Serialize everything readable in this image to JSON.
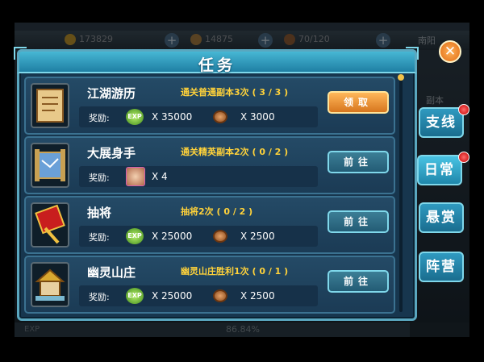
{
  "hud": {
    "res1": "173829",
    "res2": "14875",
    "res3": "70/120",
    "right_tag": "南阳",
    "side_label": "副本",
    "exp_label": "EXP",
    "exp_percent": "86.84%",
    "exp_fraction": 0.8684
  },
  "window": {
    "title": "任务",
    "close_icon": "close-x-icon"
  },
  "tasks": [
    {
      "name": "江湖游历",
      "desc": "通关普通副本3次 ( 3 / 3 )",
      "icon": "scroll-icon",
      "reward_label": "奖励:",
      "reward1_icon": "exp-icon",
      "reward1_amount": "X 35000",
      "reward2_icon": "copper-coin-icon",
      "reward2_amount": "X 3000",
      "button": "领取",
      "button_type": "claim"
    },
    {
      "name": "大展身手",
      "desc": "通关精英副本2次 ( 0 / 2 )",
      "icon": "map-scroll-icon",
      "reward_label": "奖励:",
      "reward1_icon": "hero-portrait-icon",
      "reward1_amount": "X 4",
      "button": "前往",
      "button_type": "go"
    },
    {
      "name": "抽将",
      "desc": "抽将2次 ( 0 / 2 )",
      "icon": "command-token-icon",
      "reward_label": "奖励:",
      "reward1_icon": "exp-icon",
      "reward1_amount": "X 25000",
      "reward2_icon": "copper-coin-icon",
      "reward2_amount": "X 2500",
      "button": "前往",
      "button_type": "go"
    },
    {
      "name": "幽灵山庄",
      "desc": "幽灵山庄胜利1次 ( 0 / 1 )",
      "icon": "mansion-icon",
      "reward_label": "奖励:",
      "reward1_icon": "exp-icon",
      "reward1_amount": "X 25000",
      "reward2_icon": "copper-coin-icon",
      "reward2_amount": "X 2500",
      "button": "前往",
      "button_type": "go"
    }
  ],
  "exp_icon_text": "EXP",
  "side_tabs": [
    {
      "label": "支线",
      "badge": true,
      "active": false
    },
    {
      "label": "日常",
      "badge": true,
      "active": true
    },
    {
      "label": "悬赏",
      "badge": false,
      "active": false
    },
    {
      "label": "阵营",
      "badge": false,
      "active": false
    }
  ],
  "colors": {
    "panel": "#17364e",
    "border": "#5aa7bf",
    "title_bar": "#2d9bc0",
    "desc_text": "#ffd23a",
    "claim_button": "#e48a2a",
    "badge": "#e01010"
  }
}
